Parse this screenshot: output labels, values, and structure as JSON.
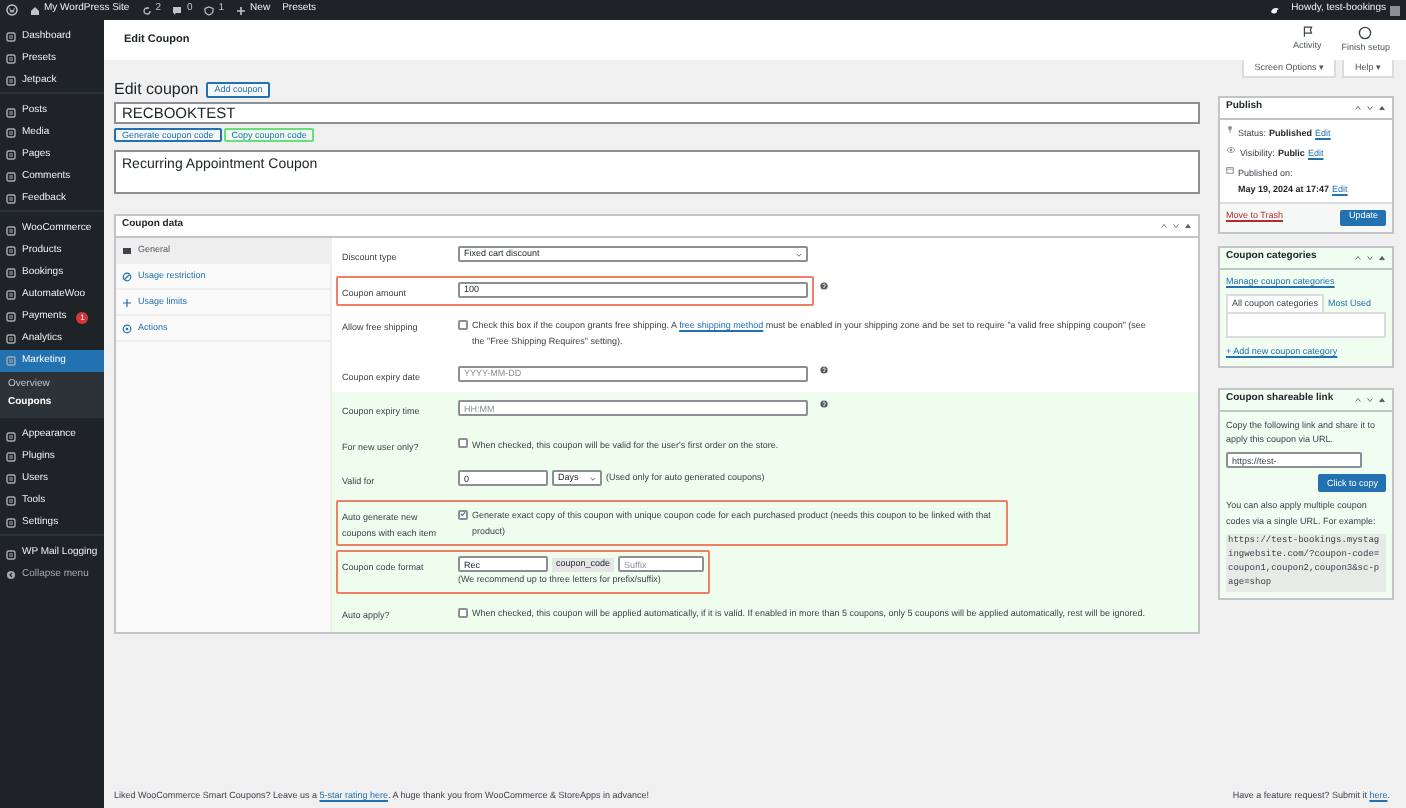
{
  "admin_bar": {
    "site_title": "My WordPress Site",
    "updates": "2",
    "comments": "0",
    "alerts": "1",
    "new": "New",
    "presets": "Presets",
    "greeting": "Howdy, test-bookings"
  },
  "sidebar": {
    "items": [
      {
        "label": "Dashboard",
        "selected": false,
        "separator_before": false
      },
      {
        "label": "Presets",
        "selected": false,
        "separator_before": false
      },
      {
        "label": "Jetpack",
        "selected": false,
        "separator_before": false
      },
      {
        "label": "Posts",
        "selected": false,
        "separator_before": true
      },
      {
        "label": "Media",
        "selected": false,
        "separator_before": false
      },
      {
        "label": "Pages",
        "selected": false,
        "separator_before": false
      },
      {
        "label": "Comments",
        "selected": false,
        "separator_before": false
      },
      {
        "label": "Feedback",
        "selected": false,
        "separator_before": false
      },
      {
        "label": "WooCommerce",
        "selected": false,
        "separator_before": true
      },
      {
        "label": "Products",
        "selected": false,
        "separator_before": false
      },
      {
        "label": "Bookings",
        "selected": false,
        "separator_before": false
      },
      {
        "label": "AutomateWoo",
        "selected": false,
        "separator_before": false
      },
      {
        "label": "Payments",
        "selected": false,
        "separator_before": false,
        "badge": "1"
      },
      {
        "label": "Analytics",
        "selected": false,
        "separator_before": false
      },
      {
        "label": "Marketing",
        "selected": true,
        "separator_before": false,
        "children": [
          {
            "label": "Overview",
            "selected": false
          },
          {
            "label": "Coupons",
            "selected": true
          }
        ]
      },
      {
        "label": "Appearance",
        "selected": false,
        "separator_before": true
      },
      {
        "label": "Plugins",
        "selected": false,
        "separator_before": false
      },
      {
        "label": "Users",
        "selected": false,
        "separator_before": false
      },
      {
        "label": "Tools",
        "selected": false,
        "separator_before": false
      },
      {
        "label": "Settings",
        "selected": false,
        "separator_before": false
      },
      {
        "label": "WP Mail Logging",
        "selected": false,
        "separator_before": true
      }
    ],
    "collapse": "Collapse menu"
  },
  "header": {
    "title": "Edit Coupon",
    "actions": [
      "Activity",
      "Finish setup"
    ]
  },
  "screen_buttons": [
    "Screen Options ▾",
    "Help ▾"
  ],
  "page_title": "Edit coupon",
  "add_button": "Add coupon",
  "coupon_code": "RECBOOKTEST",
  "code_buttons": [
    "Generate coupon code",
    "Copy coupon code"
  ],
  "description": "Recurring Appointment Coupon",
  "coupon_data": {
    "title": "Coupon data",
    "tabs": [
      {
        "label": "General",
        "selected": true
      },
      {
        "label": "Usage restriction",
        "selected": false
      },
      {
        "label": "Usage limits",
        "selected": false
      },
      {
        "label": "Actions",
        "selected": false
      }
    ],
    "fields": [
      {
        "kind": "select",
        "label": "Discount type",
        "value": "Fixed cart discount",
        "help": false,
        "highlighted": false,
        "shaded": false
      },
      {
        "kind": "text",
        "label": "Coupon amount",
        "value": "100",
        "help": true,
        "highlighted": true,
        "shaded": false
      },
      {
        "kind": "checkbox",
        "label": "Allow free shipping",
        "checked": false,
        "description": "Check this box if the coupon grants free shipping. A ",
        "link": "free shipping method",
        "description_end": " must be enabled in your shipping zone and be set to require \"a valid free shipping coupon\" (see the \"Free Shipping Requires\" setting).",
        "help": false,
        "highlighted": false,
        "shaded": false
      },
      {
        "kind": "text",
        "label": "Coupon expiry date",
        "placeholder": "YYYY-MM-DD",
        "help": true,
        "highlighted": false,
        "shaded": false
      },
      {
        "kind": "text",
        "label": "Coupon expiry time",
        "placeholder": "HH:MM",
        "help": true,
        "highlighted": false,
        "shaded": true
      },
      {
        "kind": "checkbox",
        "label": "For new user only?",
        "checked": false,
        "description": "When checked, this coupon will be valid for the user's first order on the store.",
        "help": false,
        "highlighted": false,
        "shaded": true
      },
      {
        "kind": "valid_for",
        "label": "Valid for",
        "value": "0",
        "unit": "Days",
        "note": "(Used only for auto generated coupons)",
        "help": false,
        "highlighted": false,
        "shaded": true
      },
      {
        "kind": "checkbox",
        "label": "Auto generate new coupons with each item",
        "checked": true,
        "description": "Generate exact copy of this coupon with unique coupon code for each purchased product (needs this coupon to be linked with that product)",
        "help": false,
        "highlighted": true,
        "shaded": true
      },
      {
        "kind": "code_format",
        "label": "Coupon code format",
        "prefix": "Rec",
        "middle": "coupon_code",
        "suffix_placeholder": "Suffix",
        "note": "(We recommend up to three letters for prefix/suffix)",
        "help": false,
        "highlighted": true,
        "shaded": true
      },
      {
        "kind": "checkbox",
        "label": "Auto apply?",
        "checked": false,
        "description": "When checked, this coupon will be applied automatically, if it is valid. If enabled in more than 5 coupons, only 5 coupons will be applied automatically, rest will be ignored.",
        "help": false,
        "highlighted": false,
        "shaded": true
      }
    ]
  },
  "publish": {
    "title": "Publish",
    "rows": [
      {
        "label": "Status:",
        "value": "Published",
        "link": "Edit"
      },
      {
        "label": "Visibility:",
        "value": "Public",
        "link": "Edit"
      },
      {
        "label": "Published on:",
        "value": "May 19, 2024 at 17:47",
        "link": "Edit"
      }
    ],
    "trash": "Move to Trash",
    "update": "Update"
  },
  "categories": {
    "title": "Coupon categories",
    "manage": "Manage coupon categories",
    "tabs": [
      {
        "label": "All coupon categories",
        "selected": true
      },
      {
        "label": "Most Used",
        "selected": false
      }
    ],
    "add": "+ Add new coupon category"
  },
  "shareable": {
    "title": "Coupon shareable link",
    "intro": "Copy the following link and share it to apply this coupon via URL.",
    "url": "https://test-",
    "button": "Click to copy",
    "note": "You can also apply multiple coupon codes via a single URL. For example:",
    "example": "https://test-bookings.mystagingwebsite.com/?coupon-code=coupon1,coupon2,coupon3&sc-page=shop"
  },
  "footer": {
    "text": "Liked WooCommerce Smart Coupons? Leave us a ",
    "link": "5-star rating here",
    "text_end": ". A huge thank you from WooCommerce & StoreApps in advance!",
    "right_text": "Have a feature request? Submit it ",
    "right_link": "here",
    "right_end": "."
  }
}
